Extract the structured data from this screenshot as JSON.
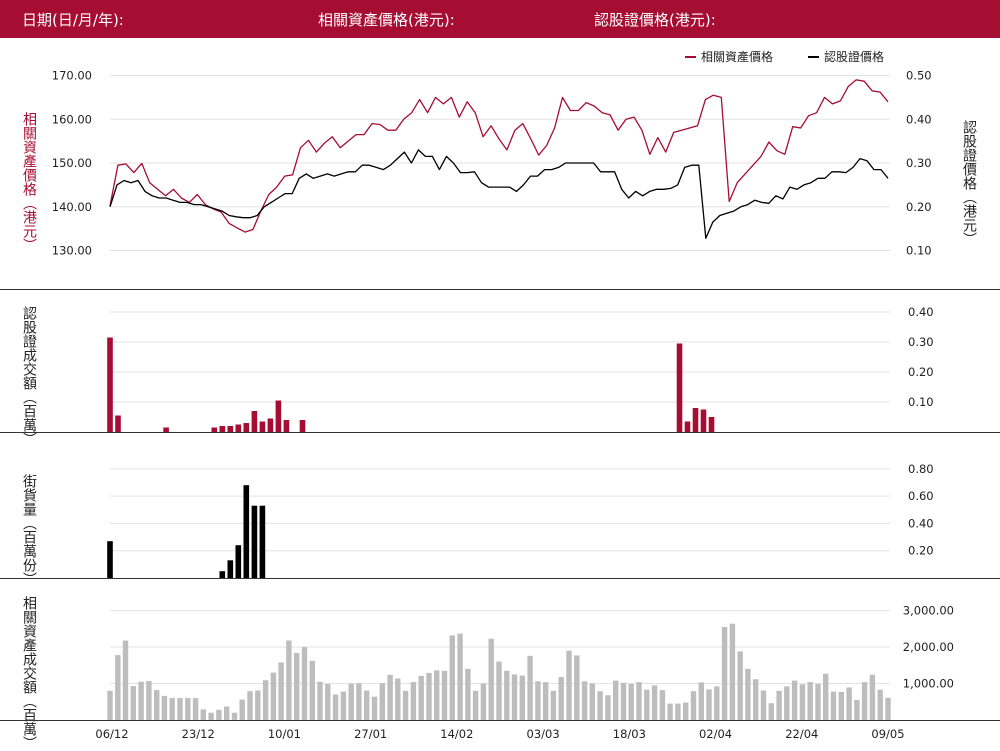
{
  "header": {
    "date_label": "日期(日/月/年):",
    "asset_price_label": "相關資產價格(港元):",
    "warrant_price_label": "認股證價格(港元):"
  },
  "colors": {
    "brand": "#a50d32",
    "asset_series": "#a50d32",
    "warrant_series": "#000000",
    "turnover_bars": "#bdbdbd",
    "gridline": "#e3e3e3"
  },
  "chart_data": [
    {
      "type": "line",
      "legend": [
        "相關資產價格",
        "認股證價格"
      ],
      "legend_position": "top-right",
      "ylabel_left": "相關資產價格（港元）",
      "ylabel_right": "認股證價格（港元）",
      "y_left_ticks": [
        "130.00",
        "140.00",
        "150.00",
        "160.00",
        "170.00"
      ],
      "y_right_ticks": [
        "0.10",
        "0.20",
        "0.30",
        "0.40",
        "0.50"
      ],
      "ylim_left": [
        126,
        174
      ],
      "ylim_right": [
        0.06,
        0.54
      ],
      "grid": true,
      "series": [
        {
          "name": "相關資產價格",
          "axis": "left",
          "values": [
            140.2,
            149.5,
            149.8,
            147.8,
            149.9,
            145.5,
            144.0,
            142.5,
            144.0,
            142.0,
            141.0,
            142.8,
            140.5,
            139.5,
            138.8,
            136.2,
            135.2,
            134.2,
            134.8,
            139.0,
            142.8,
            144.5,
            147.0,
            147.3,
            153.5,
            155.2,
            152.5,
            154.5,
            156.0,
            153.5,
            155.0,
            156.5,
            156.5,
            159.0,
            158.8,
            157.5,
            157.5,
            160.0,
            161.5,
            164.5,
            161.5,
            165.0,
            163.5,
            165.0,
            160.5,
            164.0,
            161.5,
            156.0,
            158.5,
            155.5,
            153.0,
            157.5,
            159.0,
            155.5,
            151.8,
            154.0,
            158.0,
            165.0,
            162.0,
            162.0,
            163.8,
            163.0,
            161.5,
            161.0,
            157.5,
            160.0,
            160.5,
            157.5,
            152.0,
            155.8,
            152.5,
            157.0,
            157.5,
            158.0,
            158.5,
            164.5,
            165.5,
            165.0,
            141.2,
            145.5,
            147.5,
            149.5,
            151.5,
            154.8,
            152.8,
            152.0,
            158.3,
            158.0,
            160.8,
            161.5,
            165.0,
            163.5,
            164.2,
            167.5,
            169.0,
            168.7,
            166.5,
            166.2,
            164.0
          ]
        },
        {
          "name": "認股證價格",
          "axis": "right",
          "values": [
            0.2,
            0.25,
            0.26,
            0.255,
            0.26,
            0.235,
            0.225,
            0.22,
            0.22,
            0.215,
            0.21,
            0.21,
            0.205,
            0.205,
            0.2,
            0.195,
            0.19,
            0.18,
            0.177,
            0.175,
            0.175,
            0.18,
            0.2,
            0.21,
            0.22,
            0.23,
            0.23,
            0.265,
            0.275,
            0.265,
            0.27,
            0.275,
            0.27,
            0.275,
            0.28,
            0.28,
            0.295,
            0.295,
            0.29,
            0.285,
            0.295,
            0.31,
            0.325,
            0.3,
            0.33,
            0.315,
            0.315,
            0.285,
            0.315,
            0.3,
            0.278,
            0.278,
            0.28,
            0.255,
            0.245,
            0.245,
            0.245,
            0.245,
            0.235,
            0.25,
            0.27,
            0.27,
            0.285,
            0.285,
            0.29,
            0.3,
            0.3,
            0.3,
            0.3,
            0.3,
            0.28,
            0.28,
            0.28,
            0.24,
            0.22,
            0.235,
            0.225,
            0.235,
            0.24,
            0.24,
            0.242,
            0.25,
            0.29,
            0.295,
            0.295,
            0.128,
            0.165,
            0.18,
            0.185,
            0.19,
            0.2,
            0.205,
            0.215,
            0.21,
            0.208,
            0.225,
            0.218,
            0.245,
            0.24,
            0.25,
            0.255,
            0.265,
            0.265,
            0.28,
            0.28,
            0.278,
            0.29,
            0.31,
            0.305,
            0.285,
            0.285,
            0.265
          ]
        }
      ]
    },
    {
      "type": "bar",
      "ylabel": "認股證成交額（百萬）",
      "y_ticks": [
        "0.10",
        "0.20",
        "0.30",
        "0.40"
      ],
      "ylim": [
        0,
        0.4
      ],
      "grid": true,
      "values": [
        0.315,
        0.055,
        0,
        0,
        0,
        0,
        0,
        0.015,
        0,
        0,
        0,
        0,
        0,
        0.015,
        0.02,
        0.02,
        0.025,
        0.03,
        0.07,
        0.035,
        0.045,
        0.105,
        0.04,
        0,
        0.04,
        0,
        0,
        0,
        0,
        0,
        0,
        0,
        0,
        0,
        0,
        0,
        0,
        0,
        0,
        0,
        0,
        0,
        0,
        0,
        0,
        0,
        0,
        0,
        0,
        0,
        0,
        0,
        0,
        0,
        0,
        0,
        0,
        0,
        0,
        0,
        0,
        0,
        0,
        0,
        0,
        0,
        0,
        0,
        0,
        0,
        0,
        0.295,
        0.035,
        0.08,
        0.075,
        0.05,
        0,
        0,
        0,
        0,
        0,
        0,
        0,
        0,
        0,
        0,
        0,
        0,
        0,
        0,
        0,
        0,
        0,
        0,
        0,
        0,
        0,
        0
      ]
    },
    {
      "type": "bar",
      "ylabel": "街貨量（百萬份）",
      "y_ticks": [
        "0.20",
        "0.40",
        "0.60",
        "0.80"
      ],
      "ylim": [
        0,
        0.85
      ],
      "grid": true,
      "values": [
        0.27,
        0,
        0,
        0,
        0,
        0,
        0,
        0,
        0,
        0,
        0,
        0,
        0,
        0,
        0.05,
        0.13,
        0.24,
        0.68,
        0.53,
        0.53,
        0,
        0,
        0,
        0,
        0,
        0,
        0,
        0,
        0,
        0,
        0,
        0,
        0,
        0,
        0,
        0,
        0,
        0,
        0,
        0,
        0,
        0,
        0,
        0,
        0,
        0,
        0,
        0,
        0,
        0,
        0,
        0,
        0,
        0,
        0,
        0,
        0,
        0,
        0,
        0,
        0,
        0,
        0,
        0,
        0,
        0,
        0,
        0,
        0,
        0,
        0,
        0,
        0,
        0,
        0,
        0,
        0,
        0,
        0,
        0,
        0,
        0,
        0,
        0,
        0,
        0,
        0,
        0,
        0,
        0,
        0,
        0,
        0,
        0,
        0,
        0,
        0,
        0
      ]
    },
    {
      "type": "bar",
      "ylabel": "相關資產成交額（百萬）",
      "y_ticks": [
        "1,000.00",
        "2,000.00",
        "3,000.00"
      ],
      "ylim": [
        0,
        3400
      ],
      "grid": true,
      "x_ticks": [
        "06/12",
        "23/12",
        "10/01",
        "27/01",
        "14/02",
        "03/03",
        "18/03",
        "02/04",
        "22/04",
        "09/05"
      ],
      "values": [
        800,
        1780,
        2180,
        930,
        1050,
        1070,
        820,
        660,
        600,
        600,
        600,
        600,
        290,
        200,
        280,
        370,
        200,
        560,
        790,
        810,
        1090,
        1300,
        1580,
        2180,
        1840,
        2000,
        1620,
        1050,
        990,
        700,
        780,
        1000,
        1010,
        810,
        640,
        1010,
        1240,
        1140,
        800,
        1040,
        1210,
        1290,
        1360,
        1350,
        2320,
        2370,
        1400,
        800,
        1000,
        2230,
        1600,
        1350,
        1250,
        1220,
        1760,
        1060,
        1040,
        800,
        1180,
        1900,
        1770,
        1060,
        1000,
        790,
        680,
        1080,
        1020,
        990,
        1040,
        830,
        950,
        820,
        450,
        450,
        480,
        790,
        1030,
        840,
        920,
        2550,
        2640,
        1880,
        1400,
        1120,
        810,
        460,
        800,
        920,
        1080,
        980,
        1040,
        990,
        1270,
        780,
        770,
        890,
        550,
        1040,
        1240,
        830,
        610
      ]
    }
  ]
}
